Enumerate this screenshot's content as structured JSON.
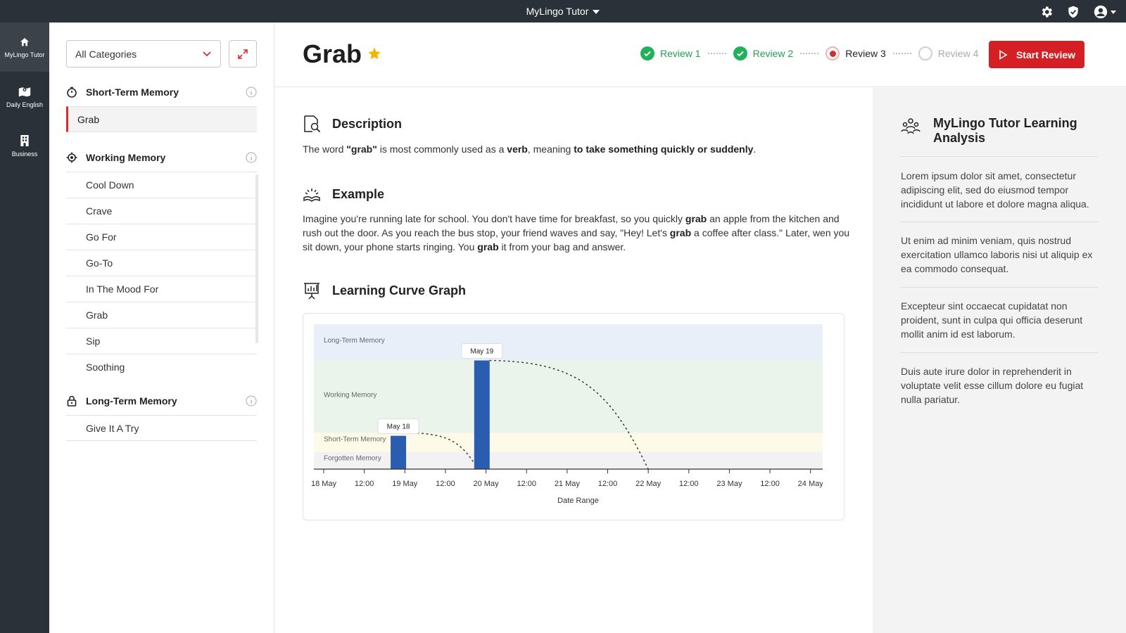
{
  "topbar": {
    "app_name": "MyLingo Tutor",
    "icons": [
      "gear-icon",
      "badge-check-icon",
      "account-icon"
    ]
  },
  "rail": {
    "items": [
      {
        "label": "MyLingo Tutor",
        "icon": "home-icon",
        "active": true
      },
      {
        "label": "Daily English",
        "icon": "map-icon",
        "active": false
      },
      {
        "label": "Business",
        "icon": "building-icon",
        "active": false
      }
    ]
  },
  "categories": {
    "select_value": "All Categories",
    "groups": [
      {
        "title": "Short-Term Memory",
        "items": [
          "Grab"
        ],
        "selected": "Grab"
      },
      {
        "title": "Working Memory",
        "items": [
          "Cool Down",
          "Crave",
          "Go For",
          "Go-To",
          "In The Mood For",
          "Grab",
          "Sip",
          "Soothing"
        ]
      },
      {
        "title": "Long-Term Memory",
        "items": [
          "Give It A Try"
        ]
      }
    ]
  },
  "header": {
    "word": "Grab",
    "steps": [
      {
        "label": "Review 1",
        "state": "done"
      },
      {
        "label": "Review 2",
        "state": "done"
      },
      {
        "label": "Review 3",
        "state": "current"
      },
      {
        "label": "Review 4",
        "state": "todo"
      }
    ],
    "start_label": "Start Review"
  },
  "description": {
    "title": "Description",
    "text": [
      {
        "t": "The word "
      },
      {
        "t": "\"grab\"",
        "b": true
      },
      {
        "t": " is most commonly used as a "
      },
      {
        "t": "verb",
        "b": true
      },
      {
        "t": ", meaning "
      },
      {
        "t": "to take something quickly or suddenly",
        "b": true
      },
      {
        "t": "."
      }
    ]
  },
  "example": {
    "title": "Example",
    "text": [
      {
        "t": "Imagine you're running late for school. You don't have time for breakfast, so you quickly "
      },
      {
        "t": "grab",
        "b": true
      },
      {
        "t": " an apple from the kitchen and rush out the door. As you reach the bus stop, your friend waves and say, \"Hey! Let's "
      },
      {
        "t": "grab",
        "b": true
      },
      {
        "t": " a coffee after class.\" Later, wen you sit down, your phone starts ringing. You "
      },
      {
        "t": "grab",
        "b": true
      },
      {
        "t": " it from your bag and answer."
      }
    ]
  },
  "graph": {
    "title": "Learning Curve Graph",
    "chart_data": {
      "type": "bar",
      "xlabel": "Date Range",
      "x_ticks": [
        "18 May",
        "12:00",
        "19 May",
        "12:00",
        "20 May",
        "12:00",
        "21 May",
        "12:00",
        "22 May",
        "12:00",
        "23 May",
        "12:00",
        "24 May"
      ],
      "x_range_days": [
        0,
        6.15
      ],
      "bands": [
        {
          "name": "Forgotten Memory",
          "from": 0,
          "to": 0.12,
          "color": "#f2f2f2"
        },
        {
          "name": "Short-Term Memory",
          "from": 0.12,
          "to": 0.25,
          "color": "#fdfae8"
        },
        {
          "name": "Working Memory",
          "from": 0.25,
          "to": 0.75,
          "color": "#eaf4ea"
        },
        {
          "name": "Long-Term Memory",
          "from": 0.75,
          "to": 1.0,
          "color": "#e8eff8"
        }
      ],
      "bars": [
        {
          "label": "May 18",
          "day": 0.92,
          "value": 0.23
        },
        {
          "label": "May 19",
          "day": 1.95,
          "value": 0.75
        }
      ],
      "decay_curves": [
        {
          "from_day": 1.1,
          "to_day": 1.9,
          "start": 0.25,
          "end": 0.0
        },
        {
          "from_day": 2.05,
          "to_day": 4.0,
          "start": 0.75,
          "end": 0.0
        }
      ],
      "bar_color": "#2a5db0"
    }
  },
  "analysis": {
    "title": "MyLingo Tutor Learning Analysis",
    "paragraphs": [
      "Lorem ipsum dolor sit amet, consectetur adipiscing elit, sed do eiusmod tempor incididunt ut labore et dolore magna aliqua.",
      "Ut enim ad minim veniam, quis nostrud exercitation ullamco laboris nisi ut aliquip ex ea commodo consequat.",
      "Excepteur sint occaecat cupidatat non proident, sunt in culpa qui officia deserunt mollit anim id est laborum.",
      "Duis aute irure dolor in reprehenderit in voluptate velit esse cillum dolore eu fugiat nulla pariatur."
    ]
  }
}
